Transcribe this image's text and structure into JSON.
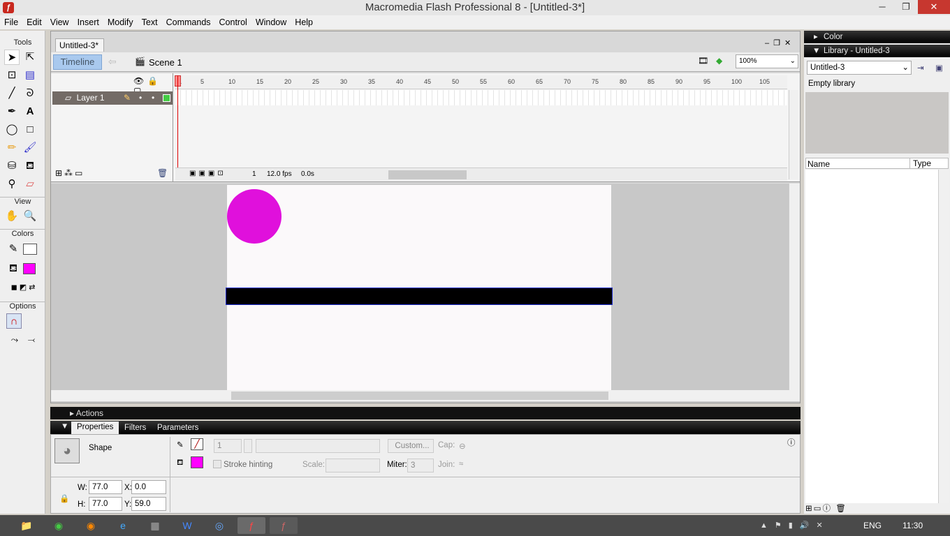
{
  "window": {
    "title": "Macromedia Flash Professional 8 - [Untitled-3*]",
    "minimize": "─",
    "restore": "❐",
    "close": "✕"
  },
  "menu": [
    "File",
    "Edit",
    "View",
    "Insert",
    "Modify",
    "Text",
    "Commands",
    "Control",
    "Window",
    "Help"
  ],
  "tools": {
    "title": "Tools",
    "view_label": "View",
    "colors_label": "Colors",
    "options_label": "Options",
    "fill_color": "#ff00ff"
  },
  "document": {
    "tab": "Untitled-3*",
    "timeline_button": "Timeline",
    "scene": "Scene 1",
    "zoom": "100%"
  },
  "timeline": {
    "layer_name": "Layer 1",
    "ruler": [
      "1",
      "5",
      "10",
      "15",
      "20",
      "25",
      "30",
      "35",
      "40",
      "45",
      "50",
      "55",
      "60",
      "65",
      "70",
      "75",
      "80",
      "85",
      "90",
      "95",
      "100",
      "105"
    ],
    "current_frame": "1",
    "fps": "12.0 fps",
    "elapsed": "0.0s"
  },
  "stage": {
    "circle_color": "#e010dc",
    "bar_color": "#000000"
  },
  "actions": {
    "label": "Actions"
  },
  "properties": {
    "tabs": [
      "Properties",
      "Filters",
      "Parameters"
    ],
    "type": "Shape",
    "stroke_height": "1",
    "custom_button": "Custom...",
    "cap_label": "Cap:",
    "stroke_hinting": "Stroke hinting",
    "scale_label": "Scale:",
    "miter_label": "Miter:",
    "miter": "3",
    "join_label": "Join:",
    "w_label": "W:",
    "w": "77.0",
    "h_label": "H:",
    "h": "77.0",
    "x_label": "X:",
    "x": "0.0",
    "y_label": "Y:",
    "y": "59.0",
    "fill_color": "#ff00ff"
  },
  "right": {
    "color_panel": "Color",
    "library_panel": "Library - Untitled-3",
    "library_select": "Untitled-3",
    "empty": "Empty library",
    "col_name": "Name",
    "col_type": "Type"
  },
  "taskbar": {
    "lang": "ENG",
    "time": "11:30"
  }
}
